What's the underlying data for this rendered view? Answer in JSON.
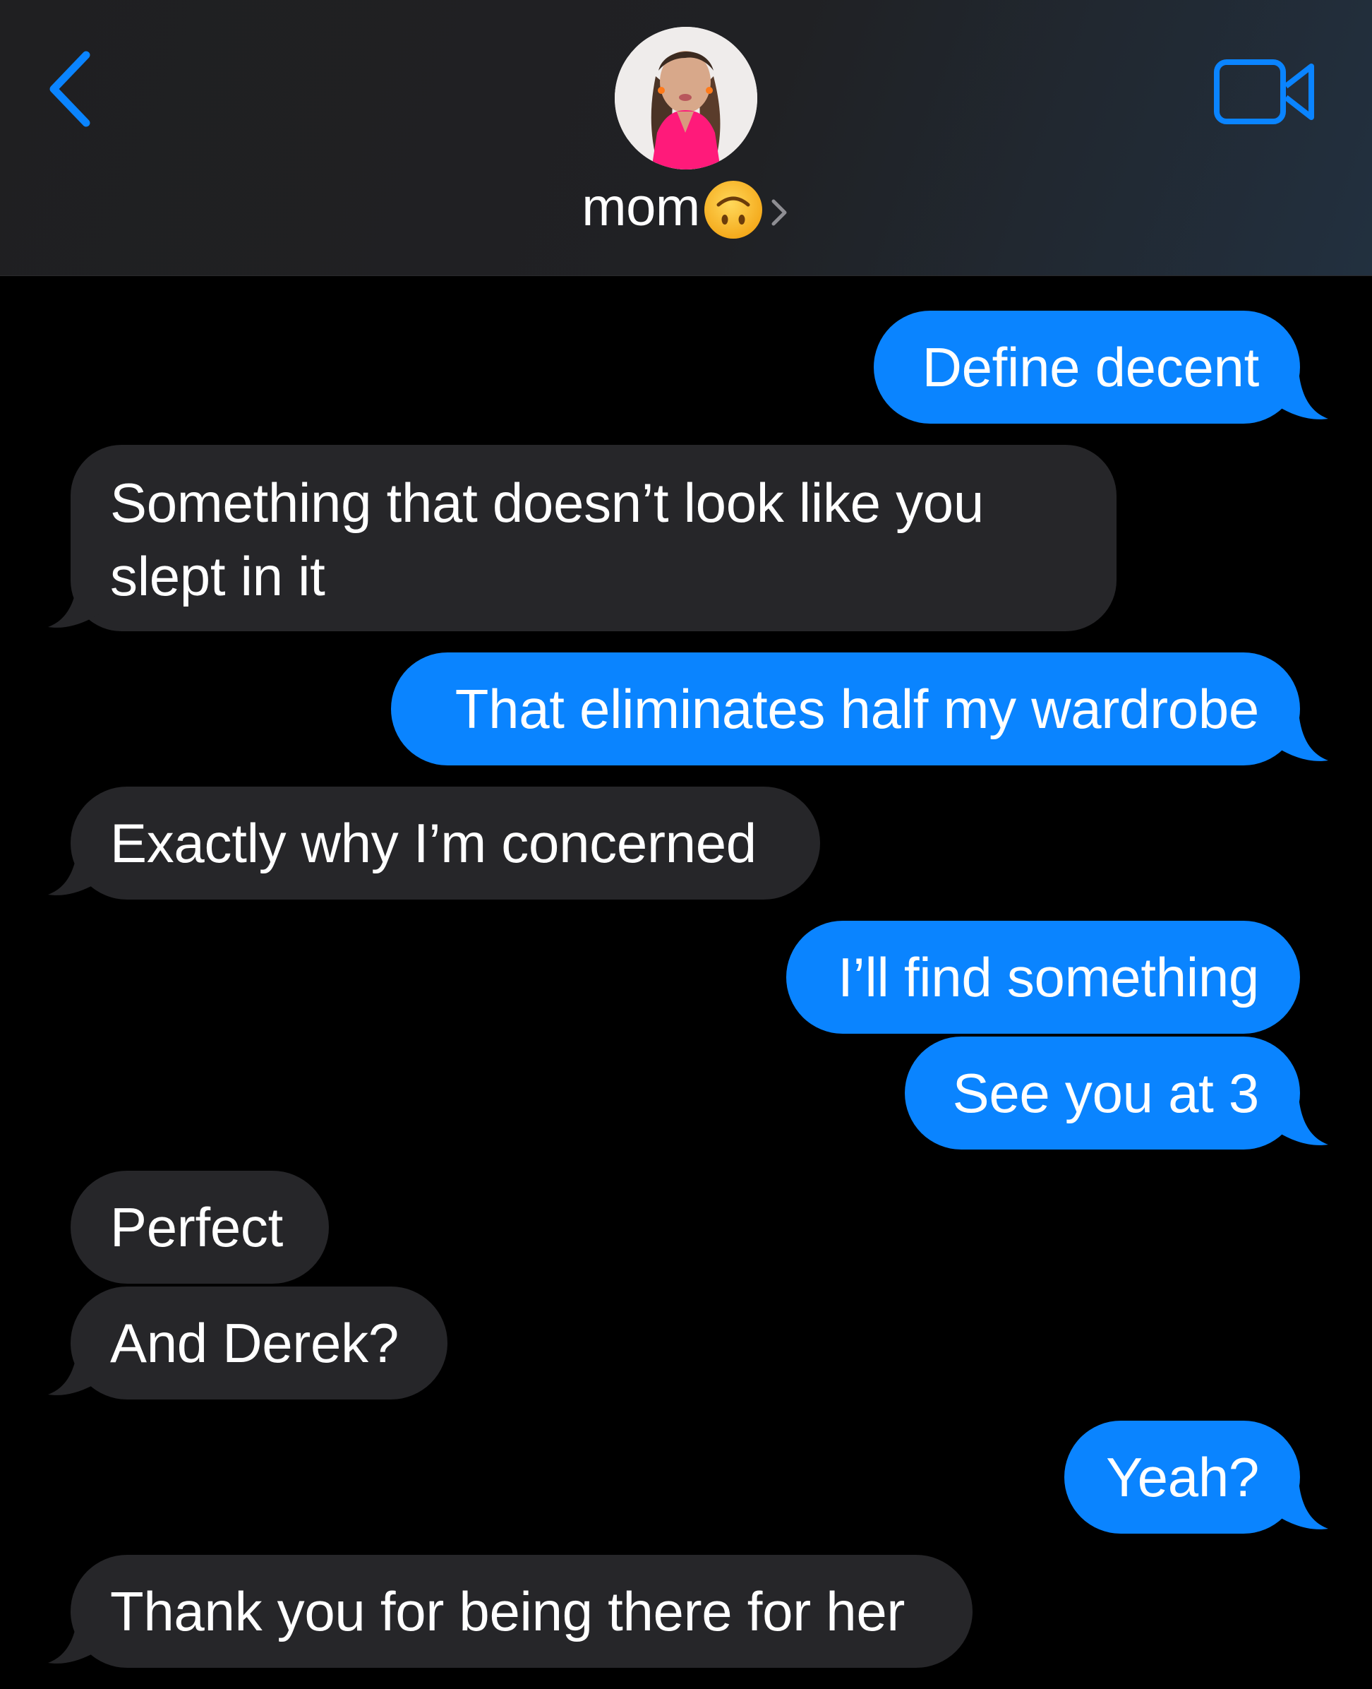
{
  "header": {
    "contact_name": "mom",
    "contact_emoji": "upside-down-face",
    "back_icon": "chevron-left-icon",
    "video_icon": "video-camera-icon",
    "accent_color": "#0a84ff"
  },
  "messages": [
    {
      "direction": "outgoing",
      "text": "Define decent"
    },
    {
      "direction": "incoming",
      "text": "Something that doesn’t look like you slept in it"
    },
    {
      "direction": "outgoing",
      "text": "That eliminates half my wardrobe"
    },
    {
      "direction": "incoming",
      "text": "Exactly why I’m concerned"
    },
    {
      "direction": "outgoing",
      "text": "I’ll find something"
    },
    {
      "direction": "outgoing",
      "text": "See you at 3"
    },
    {
      "direction": "incoming",
      "text": "Perfect"
    },
    {
      "direction": "incoming",
      "text": "And Derek?"
    },
    {
      "direction": "outgoing",
      "text": "Yeah?"
    },
    {
      "direction": "incoming",
      "text": "Thank you for being there for her"
    }
  ],
  "colors": {
    "outgoing_bubble": "#0a84ff",
    "incoming_bubble": "#262629",
    "background": "#000000"
  }
}
